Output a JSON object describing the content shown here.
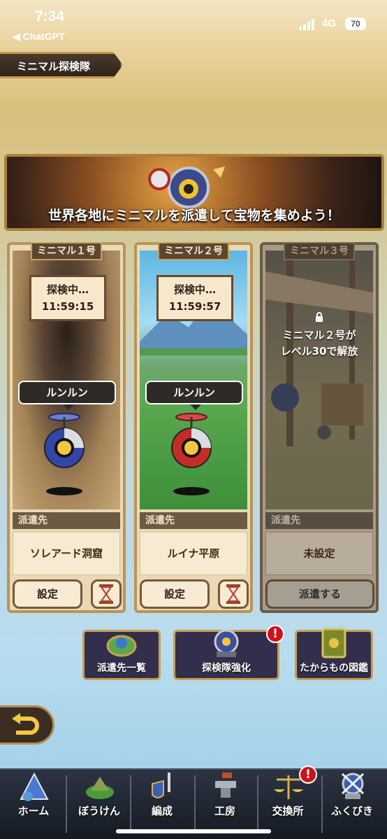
{
  "status_bar": {
    "time": "7:34",
    "back_app": "◀ ChatGPT",
    "network": "4G",
    "battery": "70"
  },
  "header": {
    "title": "ミニマル探検隊"
  },
  "banner": {
    "text": "世界各地にミニマルを派遣して宝物を集めよう！"
  },
  "cards": [
    {
      "title": "ミニマル１号",
      "status": "探検中…",
      "timer": "11:59:15",
      "bubble": "ルンルン",
      "dest_label": "派遣先",
      "dest_value": "ソレアード洞窟",
      "button": "設定"
    },
    {
      "title": "ミニマル２号",
      "status": "探検中…",
      "timer": "11:59:57",
      "bubble": "ルンルン",
      "dest_label": "派遣先",
      "dest_value": "ルイナ平原",
      "button": "設定"
    },
    {
      "title": "ミニマル３号",
      "unlock_line1": "ミニマル２号が",
      "unlock_line2": "レベル30で解放",
      "dest_label": "派遣先",
      "dest_value": "未設定",
      "button": "派遣する"
    }
  ],
  "actions": [
    {
      "label": "派遣先一覧",
      "icon": "map-icon"
    },
    {
      "label": "探検隊強化",
      "icon": "robot-icon",
      "alert": "!"
    },
    {
      "label": "たからもの図鑑",
      "icon": "book-icon"
    }
  ],
  "tabs": [
    {
      "label": "ホーム",
      "icon": "tent-icon"
    },
    {
      "label": "ぼうけん",
      "icon": "island-icon"
    },
    {
      "label": "編成",
      "icon": "sword-shield-icon"
    },
    {
      "label": "工房",
      "icon": "anvil-icon"
    },
    {
      "label": "交換所",
      "icon": "scale-icon",
      "alert": "!"
    },
    {
      "label": "ふくびき",
      "icon": "lottery-icon"
    }
  ],
  "colors": {
    "accent_gold": "#c9a050",
    "alert_red": "#d0111a"
  }
}
